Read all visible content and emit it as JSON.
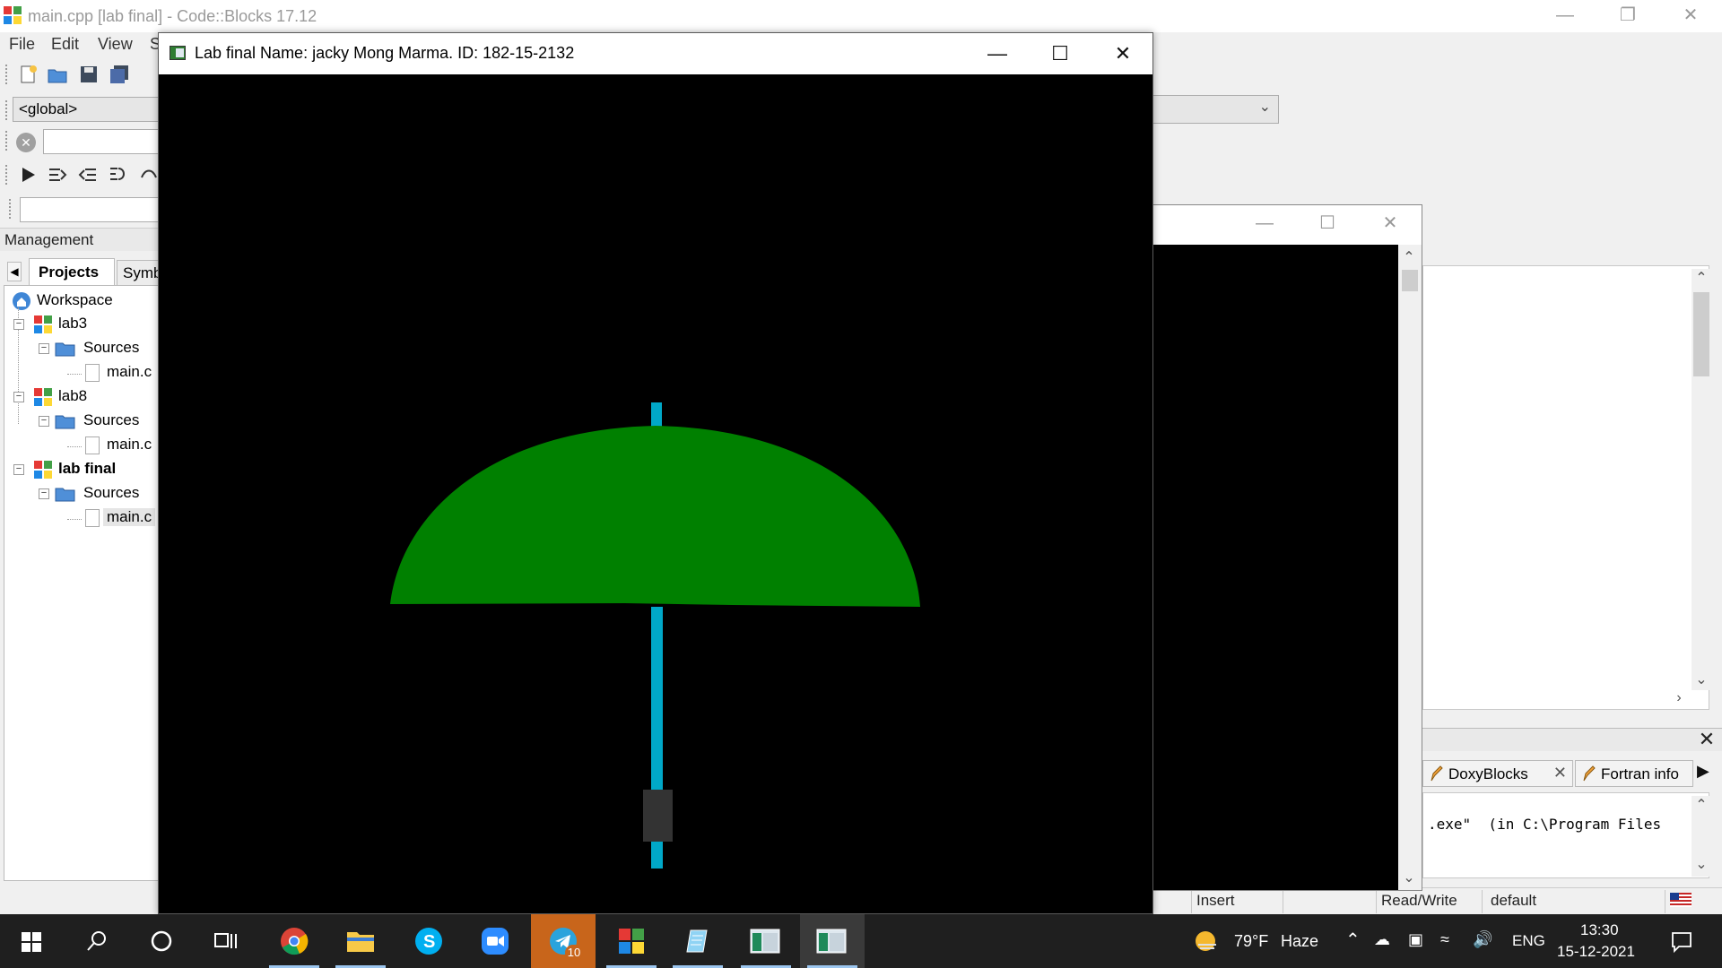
{
  "codeblocks": {
    "title": "main.cpp [lab final] - Code::Blocks 17.12",
    "menu": [
      "File",
      "Edit",
      "View",
      "S"
    ],
    "global_combo": "<global>",
    "management_label": "Management",
    "tabs": {
      "projects": "Projects",
      "symbols": "Symb"
    },
    "tree": {
      "workspace": "Workspace",
      "projects": [
        {
          "name": "lab3",
          "folder": "Sources",
          "file": "main.c"
        },
        {
          "name": "lab8",
          "folder": "Sources",
          "file": "main.c"
        },
        {
          "name": "lab final",
          "folder": "Sources",
          "file": "main.c"
        }
      ]
    },
    "log_tabs": [
      "DoxyBlocks",
      "Fortran info"
    ],
    "log_text": ".exe\"  (in C:\\Program Files",
    "status": {
      "mode": "Insert",
      "access": "Read/Write",
      "encoding": "default"
    }
  },
  "graphics_window": {
    "title": "Lab final Name: jacky Mong Marma. ID: 182-15-2132",
    "canopy_color": "#008000",
    "shaft_color": "#00a8c8",
    "handle_color": "#333333",
    "background_color": "#000000"
  },
  "taskbar": {
    "apps": [
      "start-icon",
      "search-icon",
      "cortana-icon",
      "task-view-icon",
      "chrome-icon",
      "file-explorer-icon",
      "skype-icon",
      "zoom-icon",
      "telegram-icon",
      "codeblocks-icon",
      "notepad-icon",
      "console-app-icon",
      "graphics-app-icon"
    ],
    "telegram_badge": "10",
    "weather_temp": "79°F",
    "weather_desc": "Haze",
    "language": "ENG",
    "time": "13:30",
    "date": "15-12-2021"
  }
}
